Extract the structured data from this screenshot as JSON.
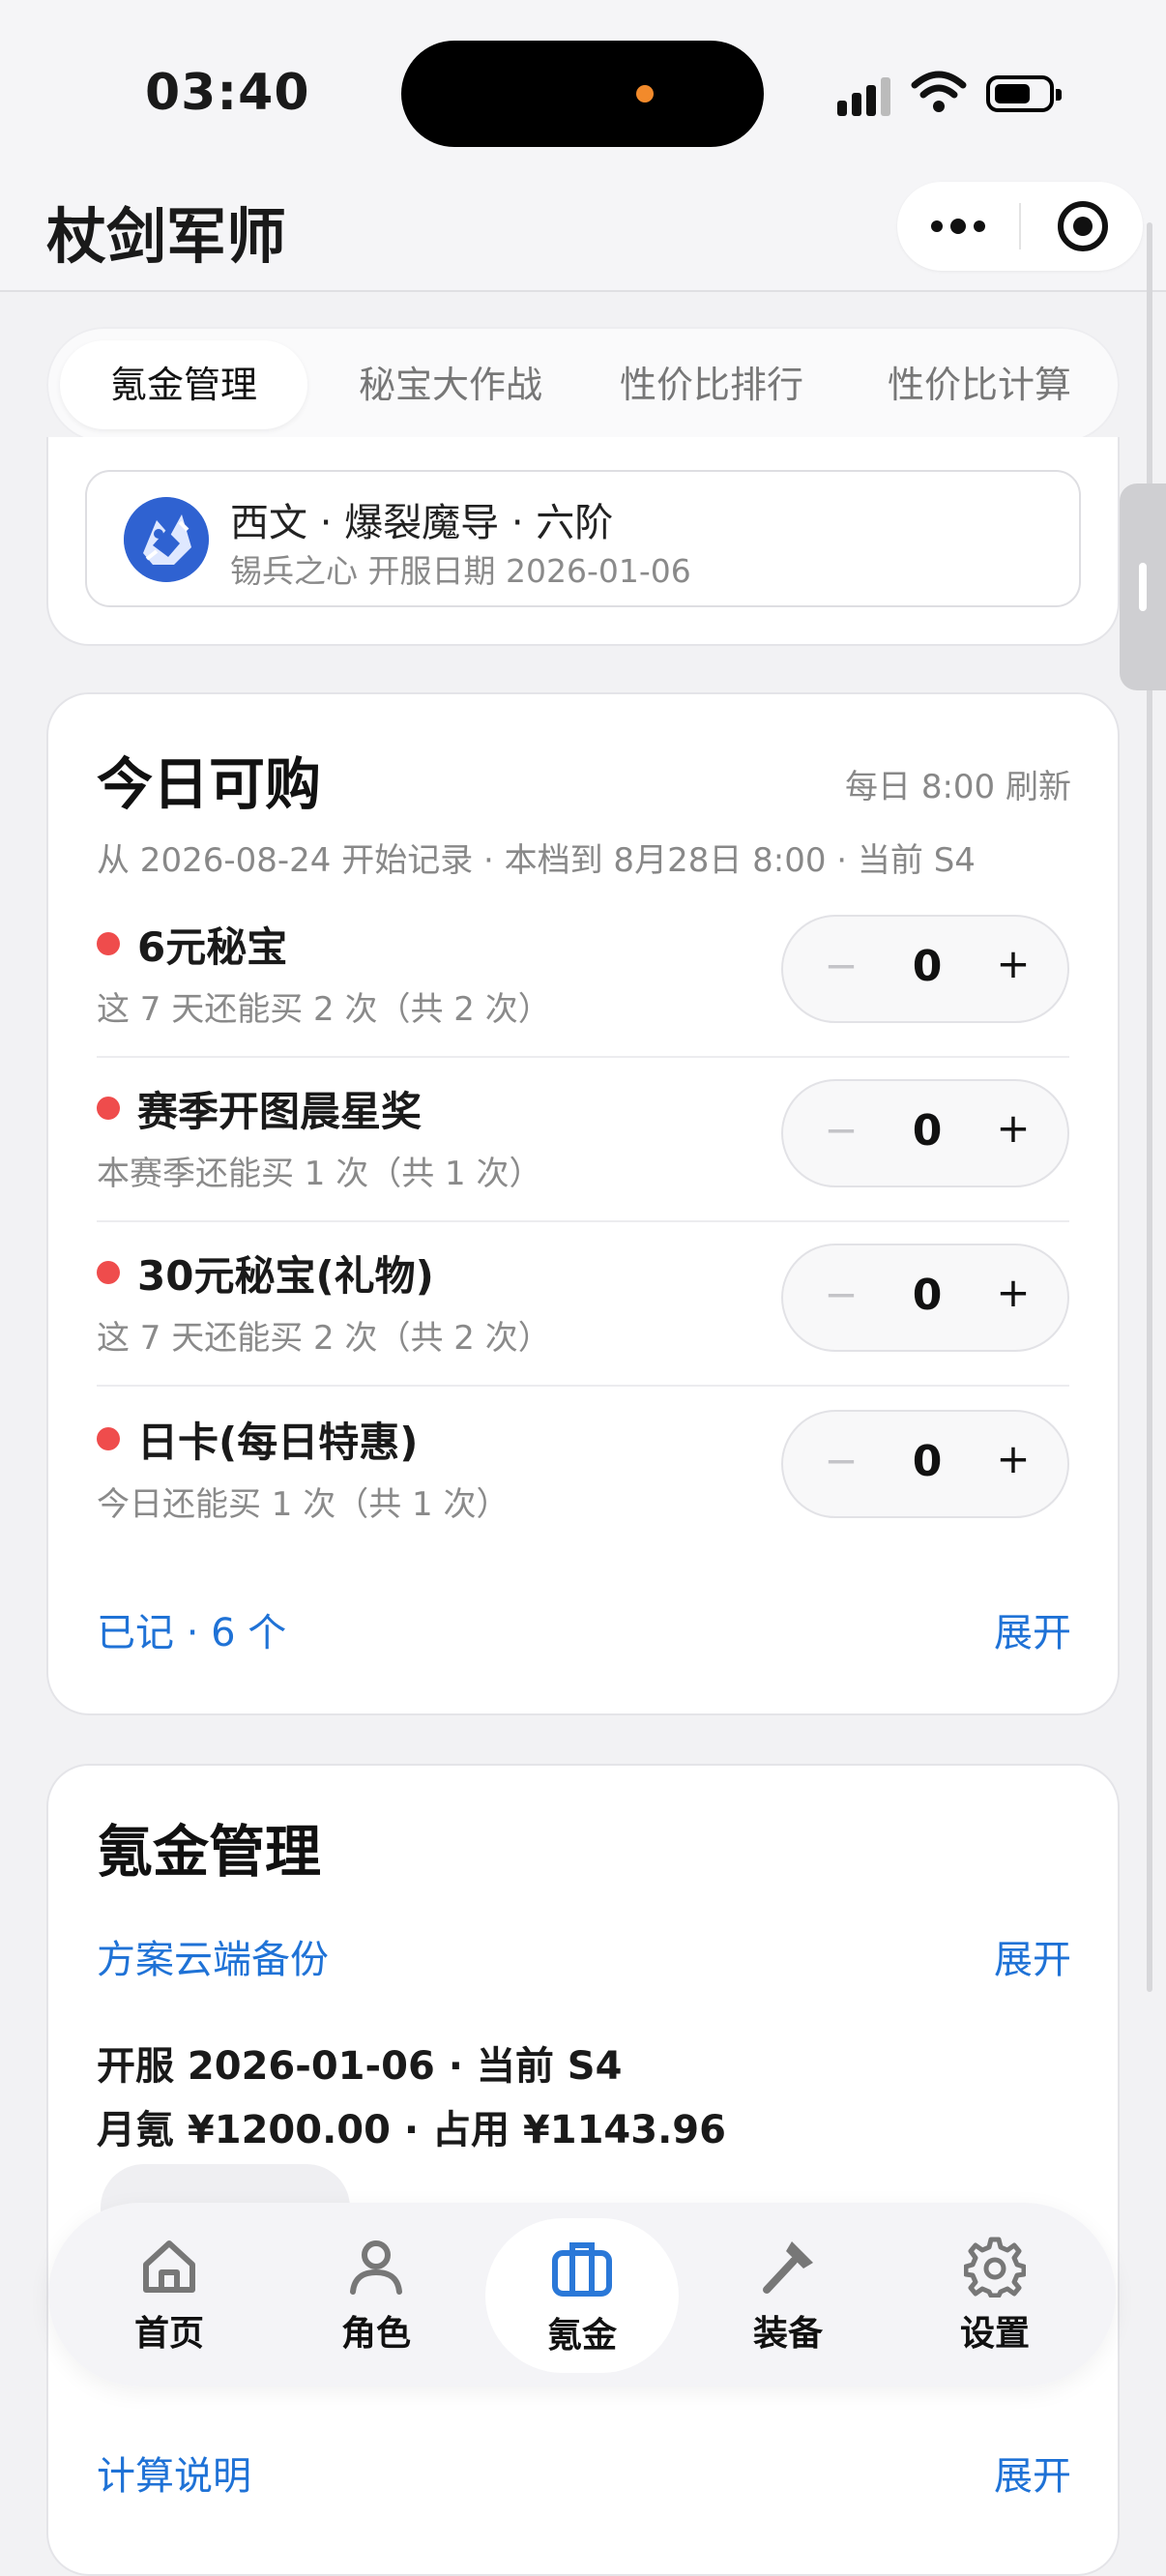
{
  "status_bar": {
    "time": "03:40"
  },
  "app": {
    "title": "杖剑军师"
  },
  "tabs": [
    {
      "label": "氪金管理",
      "active": true
    },
    {
      "label": "秘宝大作战",
      "active": false
    },
    {
      "label": "性价比排行",
      "active": false
    },
    {
      "label": "性价比计算",
      "active": false
    }
  ],
  "account": {
    "name": "西文 · 爆裂魔导 · 六阶",
    "sub": "锡兵之心 开服日期 2026-01-06"
  },
  "today": {
    "title": "今日可购",
    "refresh": "每日 8:00 刷新",
    "note": "从 2026-08-24 开始记录 · 本档到 8月28日 8:00 · 当前 S4",
    "items": [
      {
        "name": "6元秘宝",
        "sub": "这 7 天还能买 2 次（共 2 次）",
        "value": "0"
      },
      {
        "name": "赛季开图晨星奖",
        "sub": "本赛季还能买 1 次（共 1 次）",
        "value": "0"
      },
      {
        "name": "30元秘宝(礼物)",
        "sub": "这 7 天还能买 2 次（共 2 次）",
        "value": "0"
      },
      {
        "name": "日卡(每日特惠)",
        "sub": "今日还能买 1 次（共 1 次）",
        "value": "0"
      }
    ],
    "recorded": "已记 · 6 个",
    "expand": "展开"
  },
  "krypton": {
    "title": "氪金管理",
    "backup_label": "方案云端备份",
    "backup_expand": "展开",
    "line1": "开服 2026-01-06 · 当前 S4",
    "line2": "月氪 ¥1200.00 · 占用 ¥1143.96",
    "calc_label": "计算说明",
    "calc_expand": "展开"
  },
  "controls": {
    "minus": "−",
    "plus": "+"
  },
  "nav": [
    {
      "label": "首页",
      "icon": "home-icon"
    },
    {
      "label": "角色",
      "icon": "person-icon"
    },
    {
      "label": "氪金",
      "icon": "briefcase-icon",
      "active": true
    },
    {
      "label": "装备",
      "icon": "hammer-icon"
    },
    {
      "label": "设置",
      "icon": "gear-icon"
    }
  ],
  "colors": {
    "accent_blue": "#1f72d6",
    "dot_red": "#ef4c4c",
    "island_dot": "#f28a2b"
  }
}
